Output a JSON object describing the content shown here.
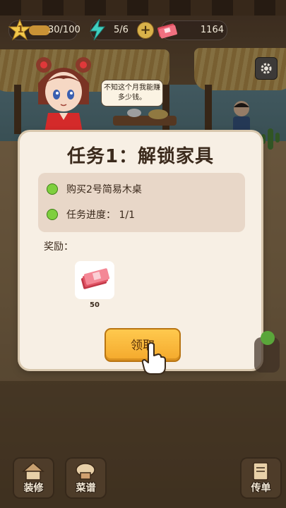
{
  "hud": {
    "level": "1",
    "xp": "30/100",
    "energy": "5/6",
    "money": "1164",
    "plus_label": "+"
  },
  "speech_bubble": "不知这个月我能赚多少钱。",
  "dialog": {
    "title": "任务1：解锁家具",
    "tasks": [
      {
        "text": "购买2号简易木桌",
        "status_color": "#7ecf3e"
      },
      {
        "text": "任务进度： 1/1",
        "status_color": "#7ecf3e"
      }
    ],
    "reward_label": "奖励：",
    "reward": {
      "icon": "cash-stack-icon",
      "quantity": "50"
    },
    "claim_label": "领取"
  },
  "bottom_nav": {
    "decor": "装修",
    "recipe": "菜谱",
    "order": "传单"
  },
  "colors": {
    "dialog_bg": "#f7efe4",
    "task_box": "#e8d7c8",
    "claim_button": "#f4a92c",
    "status_dot": "#7ecf3e"
  }
}
